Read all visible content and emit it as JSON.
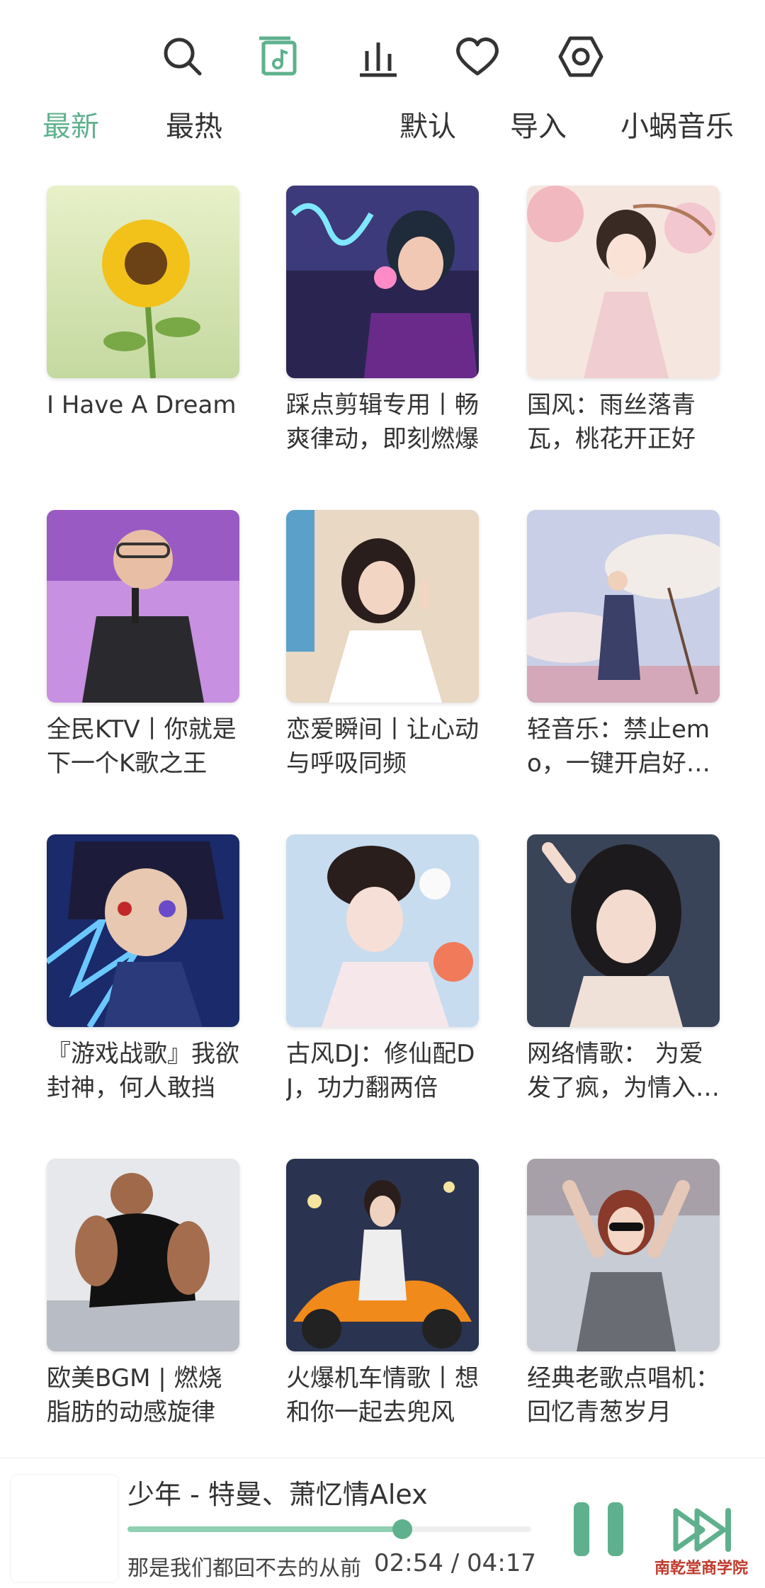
{
  "nav": {
    "icons": [
      "search-icon",
      "music-library-icon",
      "equalizer-icon",
      "heart-icon",
      "settings-icon"
    ],
    "accent": "#5fb18e"
  },
  "tabs": {
    "latest": "最新",
    "hottest": "最热",
    "default": "默认",
    "import": "导入",
    "source": "小蜗音乐"
  },
  "playlists": [
    {
      "title": "I Have A Dream"
    },
    {
      "title": "踩点剪辑专用丨畅爽律动，即刻燃爆"
    },
    {
      "title": "国风：雨丝落青瓦，桃花开正好"
    },
    {
      "title": "全民KTV丨你就是下一个K歌之王"
    },
    {
      "title": "恋爱瞬间丨让心动与呼吸同频"
    },
    {
      "title": "轻音乐：禁止emo，一键开启好心情"
    },
    {
      "title": "『游戏战歌』我欲封神，何人敢挡"
    },
    {
      "title": "古风DJ：修仙配DJ，功力翻两倍"
    },
    {
      "title": "网络情歌： 为爱发了疯，为情入了魔"
    },
    {
      "title": "欧美BGM | 燃烧脂肪的动感旋律"
    },
    {
      "title": "火爆机车情歌丨想和你一起去兜风"
    },
    {
      "title": "经典老歌点唱机：回忆青葱岁月"
    }
  ],
  "player": {
    "song": "少年 - 特曼、萧忆情Alex",
    "lyric": "那是我们都回不去的从前",
    "time": "02:54 / 04:17",
    "progress": 0.68
  },
  "watermark": "南乾堂商学院"
}
